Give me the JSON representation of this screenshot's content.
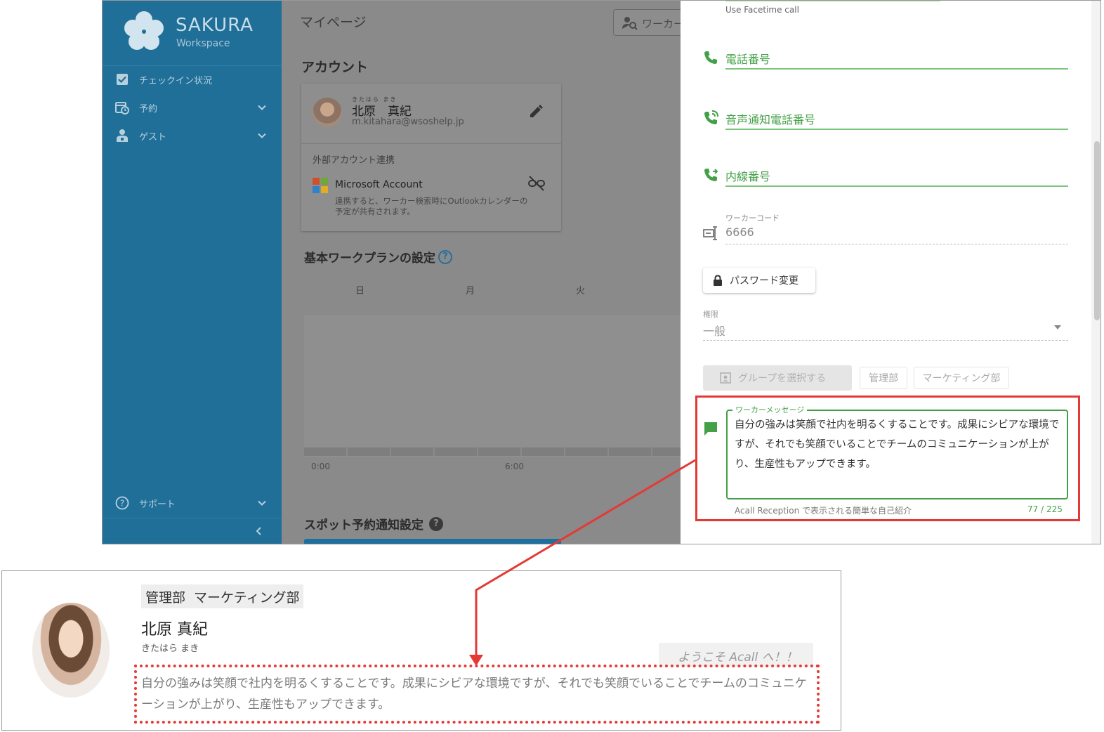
{
  "app": {
    "logo_title": "SAKURA",
    "logo_subtitle": "Workspace",
    "sidebar": {
      "items": [
        {
          "label": "チェックイン状況",
          "icon": "checkbox-icon",
          "expandable": false
        },
        {
          "label": "予約",
          "icon": "calendar-clock-icon",
          "expandable": true
        },
        {
          "label": "ゲスト",
          "icon": "guest-badge-icon",
          "expandable": true
        }
      ],
      "support_label": "サポート"
    },
    "main": {
      "page_title": "マイページ",
      "worker_search_placeholder": "ワーカー",
      "account_section": "アカウント",
      "account": {
        "ruby": "きたはら まき",
        "name": "北原　真紀",
        "email": "m.kitahara@wsoshelp.jp"
      },
      "external_accounts_title": "外部アカウント連携",
      "microsoft": {
        "name": "Microsoft Account",
        "description": "連携すると、ワーカー検索時にOutlookカレンダーの予定が共有されます。"
      },
      "plan_section": "基本ワークプランの設定",
      "days": [
        "日",
        "月",
        "火"
      ],
      "times": [
        "0:00",
        "6:00"
      ],
      "spot_section": "スポット予約通知設定"
    },
    "drawer": {
      "facetime_label": "Use Facetime call",
      "phone_label": "電話番号",
      "voice_phone_label": "音声通知電話番号",
      "extension_label": "内線番号",
      "worker_code_label": "ワーカーコード",
      "worker_code_value": "6666",
      "password_button": "パスワード変更",
      "permission_label": "権限",
      "permission_value": "一般",
      "group_button": "グループを選択する",
      "groups": [
        "管理部",
        "マーケティング部"
      ],
      "message_legend": "ワーカーメッセージ",
      "message_text": "自分の強みは笑顔で社内を明るくすることです。成果にシビアな環境ですが、それでも笑顔でいることでチームのコミュニケーションが上がり、生産性もアップできます。",
      "message_helper": "Acall Reception で表示される簡単な自己紹介",
      "message_count": "77 / 225"
    }
  },
  "preview": {
    "groups": [
      "管理部",
      "マーケティング部"
    ],
    "name": "北原 真紀",
    "kana": "きたはら まき",
    "welcome": "ようこそ Acall へ！！",
    "message": "自分の強みは笑顔で社内を明るくすることです。成果にシビアな環境ですが、それでも笑顔でいることでチームのコミュニケーションが上がり、生産性もアップできます。"
  },
  "colors": {
    "sidebar": "#1f6f98",
    "accent_green": "#43a047",
    "highlight_red": "#e53935"
  }
}
